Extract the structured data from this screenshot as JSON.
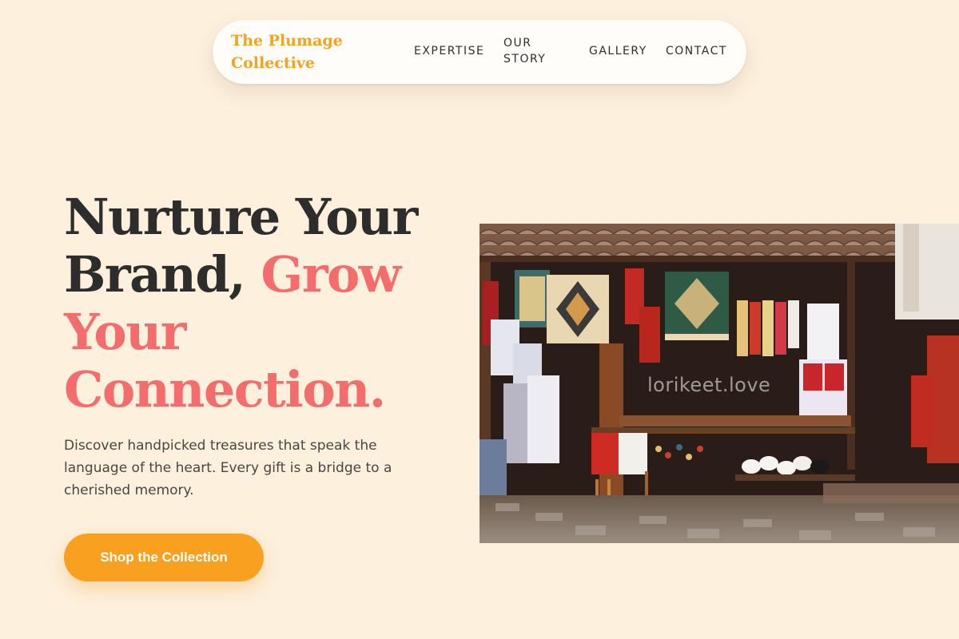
{
  "brand": {
    "name": "The Plumage Collective",
    "color": "#f4a21f"
  },
  "nav": {
    "links": [
      {
        "label": "EXPERTISE"
      },
      {
        "label": "OUR STORY"
      },
      {
        "label": "GALLERY"
      },
      {
        "label": "CONTACT"
      }
    ]
  },
  "hero": {
    "title_part1": "Nurture Your Brand, ",
    "title_accent": "Grow Your Connection.",
    "subtitle": "Discover handpicked treasures that speak the language of the heart. Every gift is a bridge to a cherished memory.",
    "cta_label": "Shop the Collection",
    "image_watermark": "lorikeet.love",
    "colors": {
      "heading": "#2d2d2d",
      "accent": "#f46d6d",
      "cta": "#f9a020",
      "background": "#fdf0dd"
    }
  }
}
